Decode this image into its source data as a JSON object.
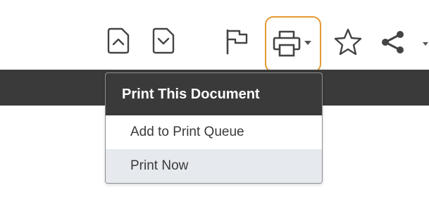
{
  "toolbar": {
    "icons": [
      "chevron-up-page-icon",
      "chevron-down-page-icon",
      "flag-icon",
      "printer-icon",
      "star-icon",
      "share-icon"
    ],
    "print_button_highlight_color": "#e49a33"
  },
  "print_menu": {
    "header": "Print This Document",
    "items": [
      {
        "label": "Add to Print Queue"
      },
      {
        "label": "Print Now",
        "highlighted": true
      }
    ]
  },
  "colors": {
    "dark_bar": "#3a3a3a",
    "menu_hover": "#e6e9ee",
    "icon": "#444444"
  }
}
